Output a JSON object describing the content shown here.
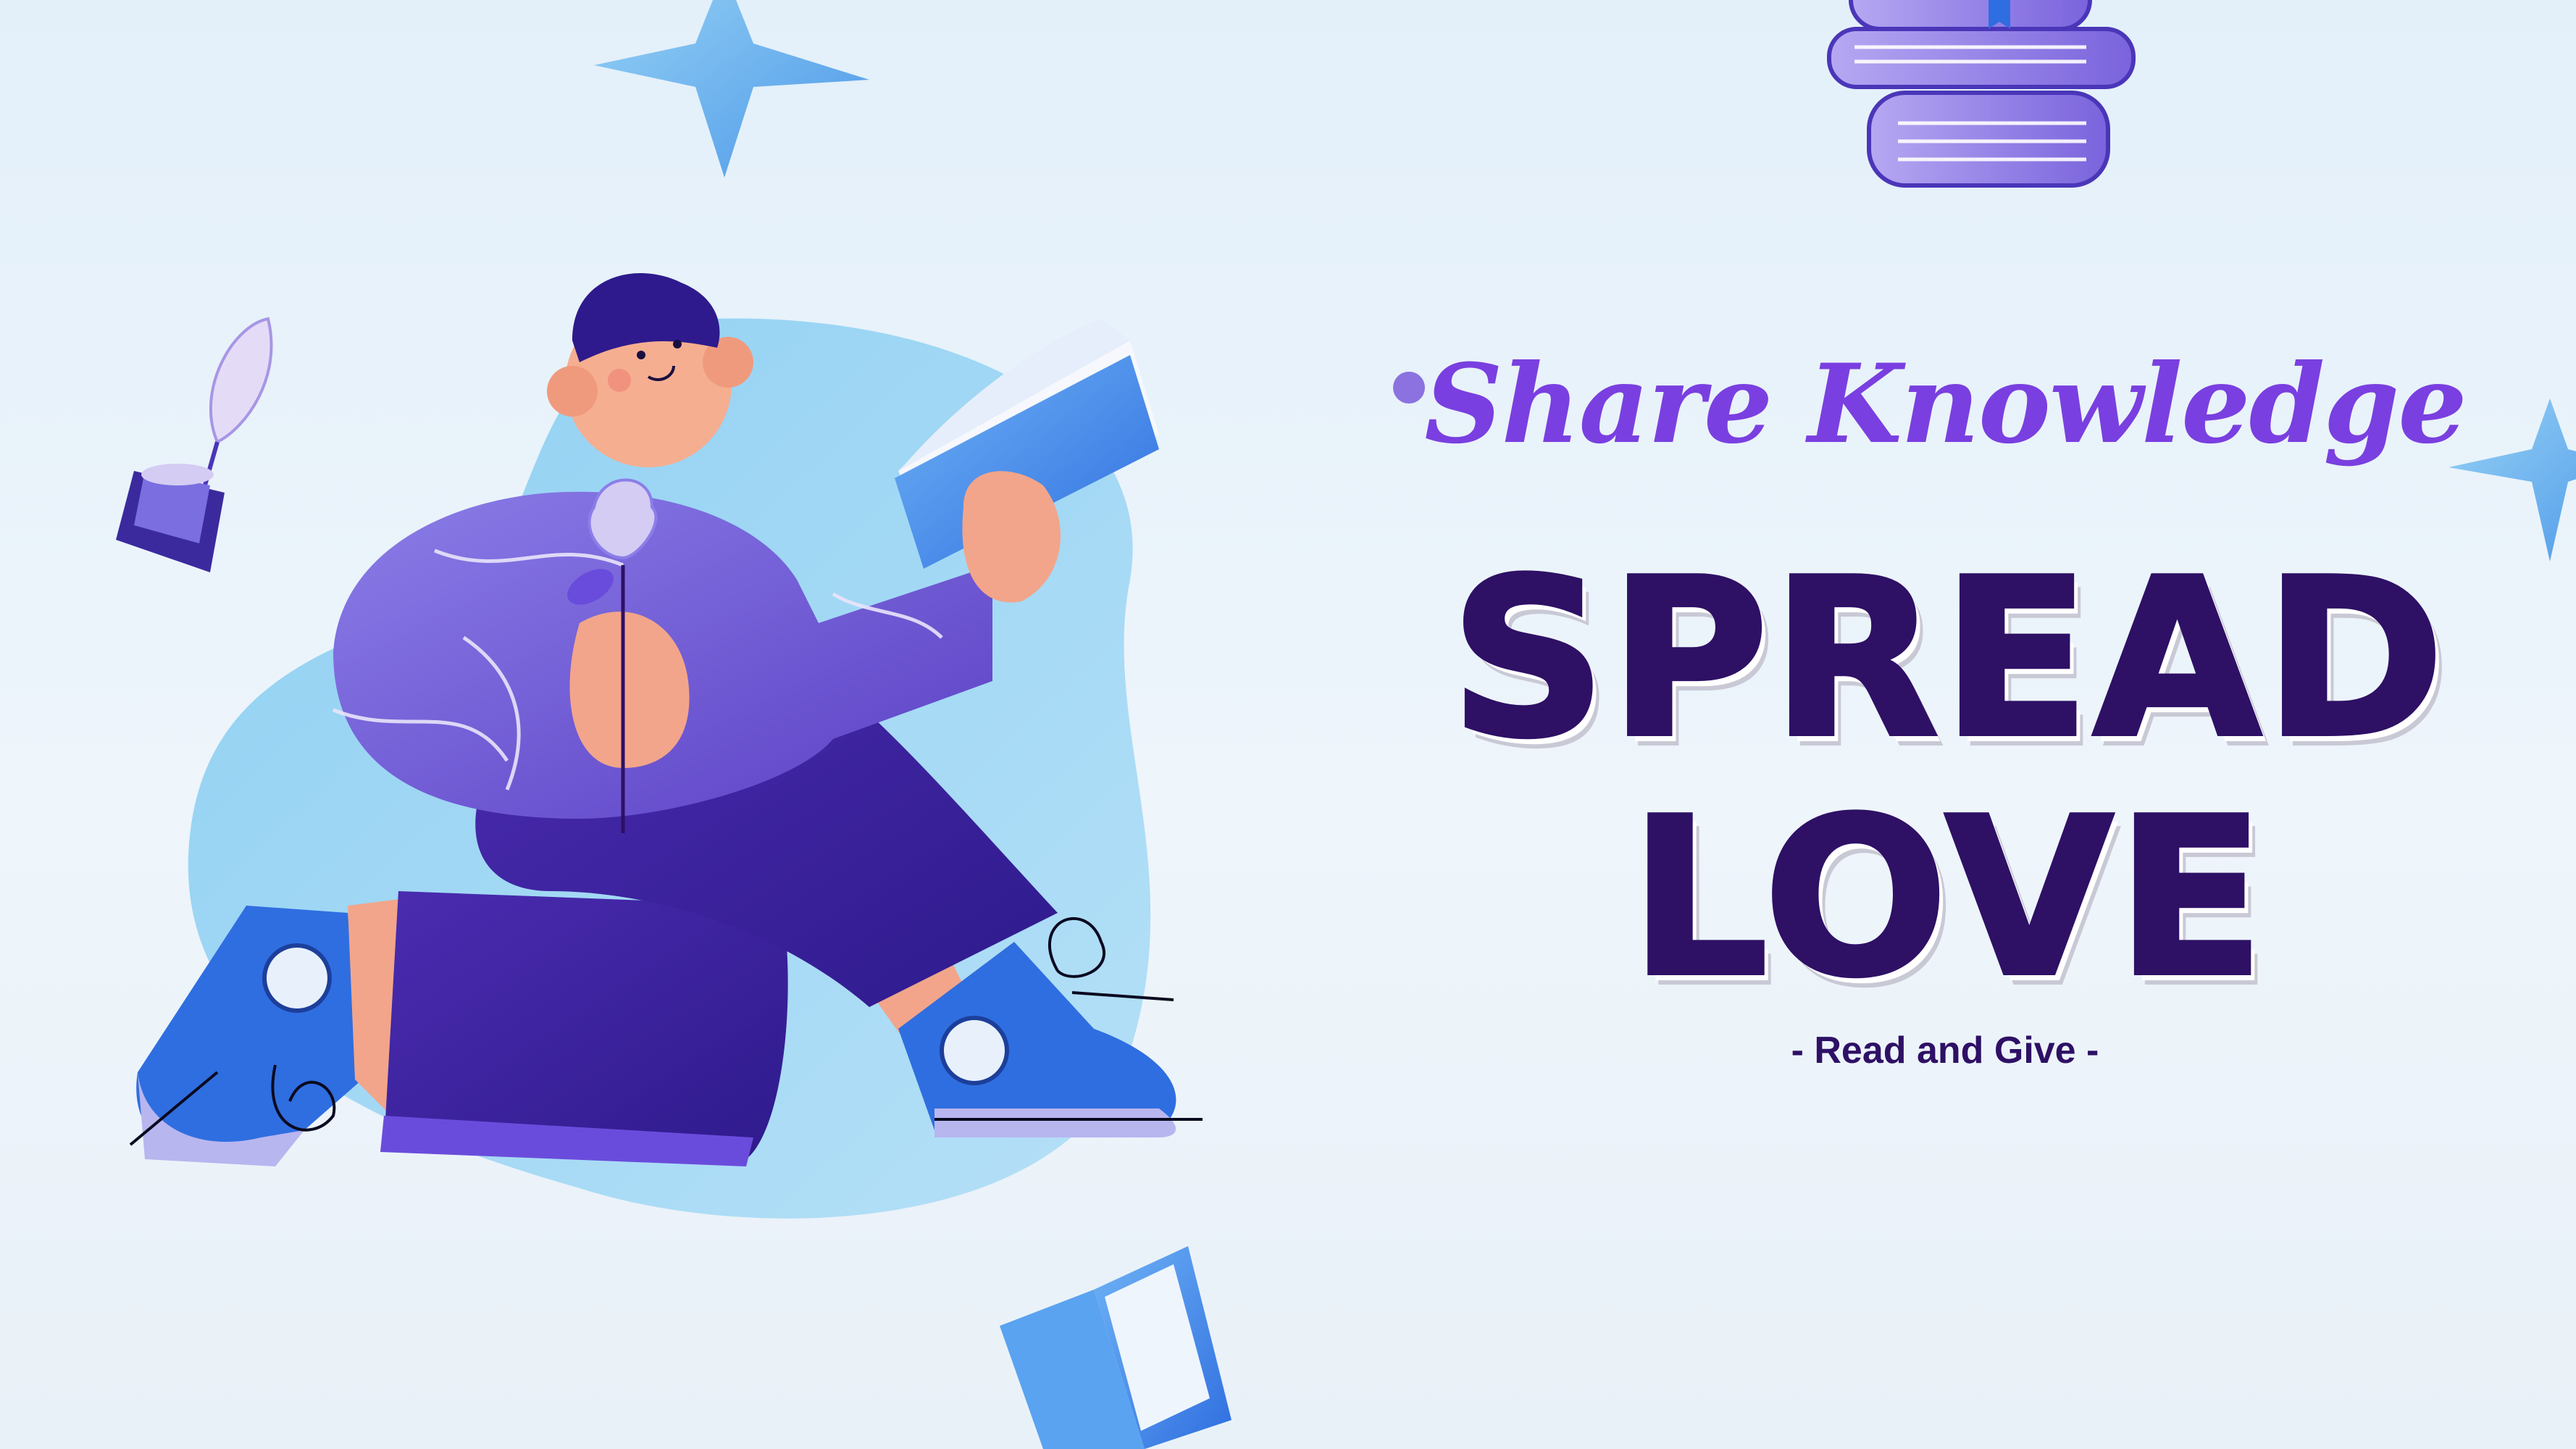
{
  "headline": {
    "script": "Share Knowledge",
    "line1": "SPREAD",
    "line2": "LOVE",
    "tagline": "- Read and Give -"
  },
  "colors": {
    "background": "#e6f1fa",
    "purple_accent": "#7a3fe0",
    "deep_purple": "#2e1065",
    "blue": "#2f7de1",
    "sky": "#8fd0f2"
  },
  "icons": [
    "sparkle-star-icon",
    "book-stack-icon",
    "inkwell-quill-icon",
    "open-book-icon",
    "reading-person-illustration"
  ]
}
